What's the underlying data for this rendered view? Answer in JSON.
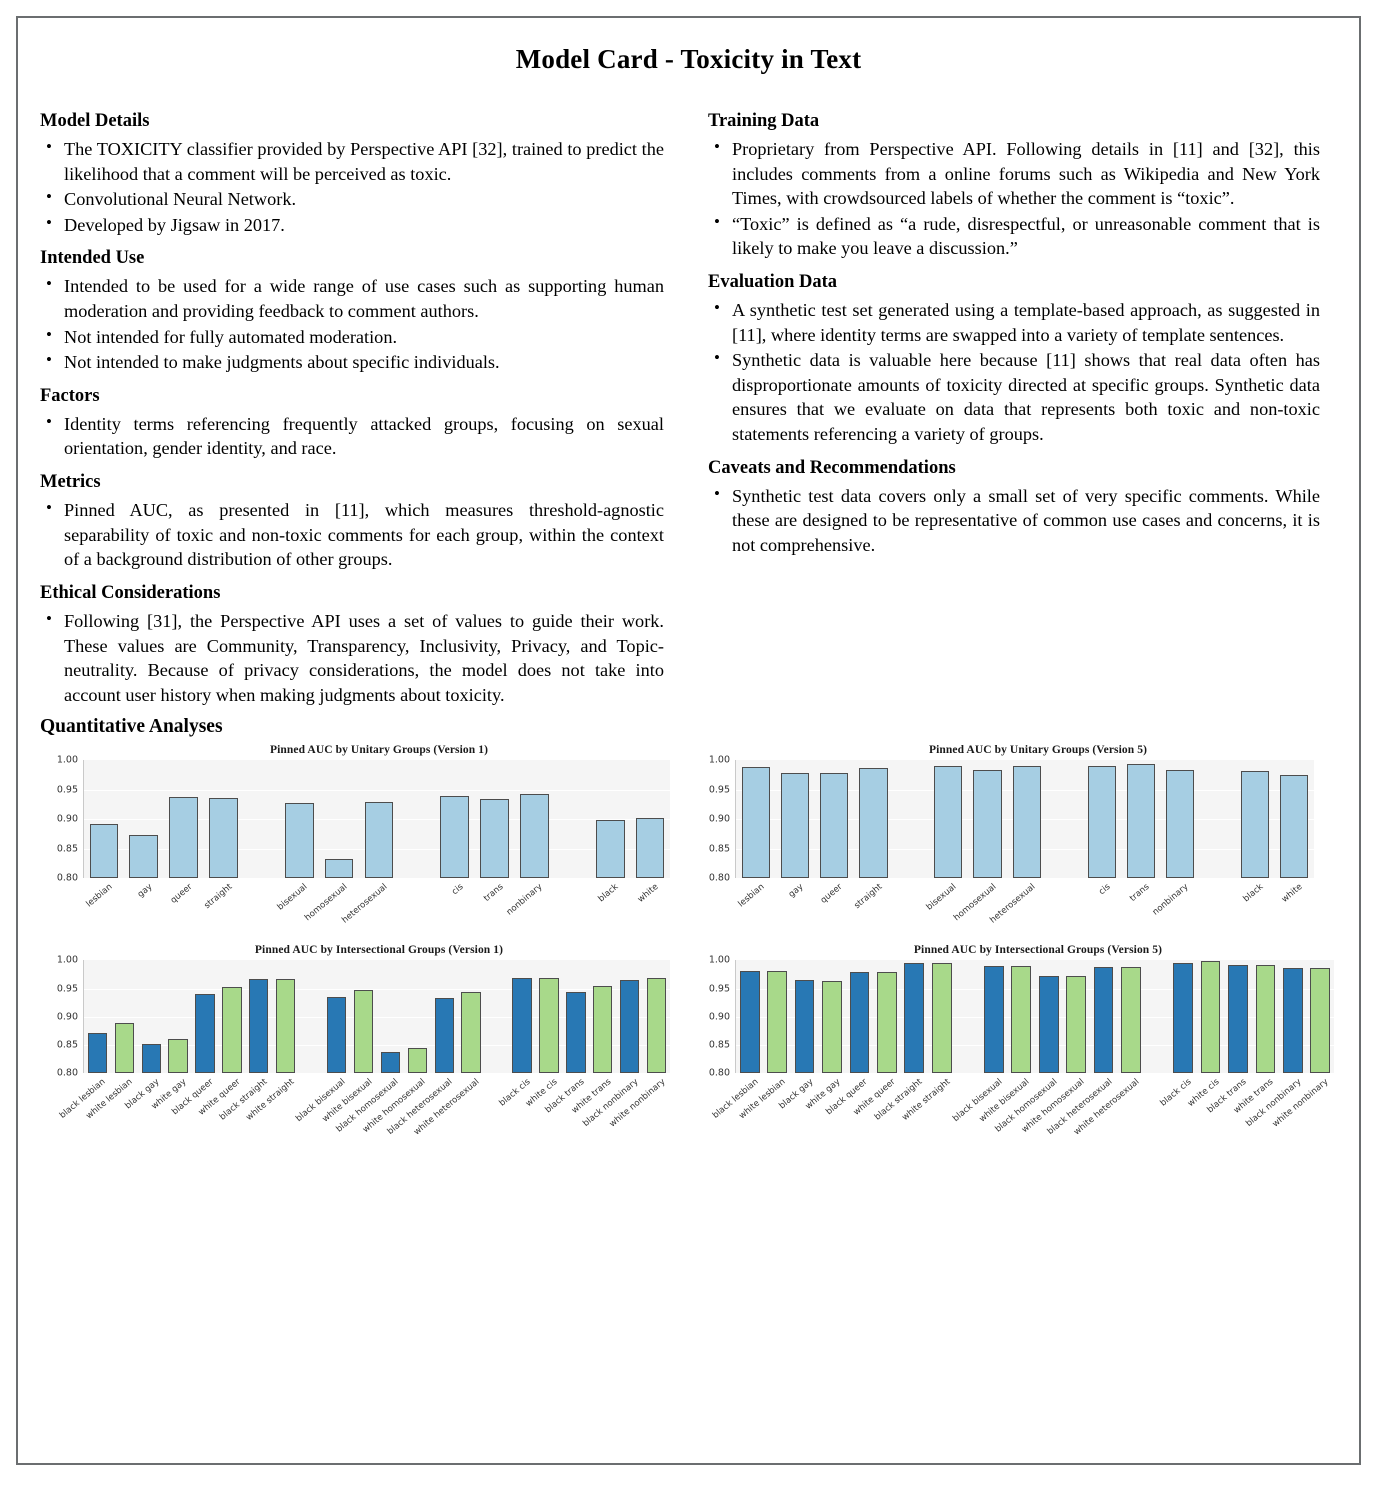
{
  "document": {
    "title": "Model Card - Toxicity in Text",
    "quantitative_analyses_heading": "Quantitative Analyses"
  },
  "left_column": [
    {
      "heading": "Model Details",
      "bullets": [
        "The TOXICITY classifier provided by Perspective API [32], trained to predict the likelihood that a comment will be perceived as toxic.",
        "Convolutional Neural Network.",
        "Developed by Jigsaw in 2017."
      ]
    },
    {
      "heading": "Intended Use",
      "bullets": [
        "Intended to be used for a wide range of use cases such as supporting human moderation and providing feedback to comment authors.",
        "Not intended for fully automated moderation.",
        "Not intended to make judgments about specific individuals."
      ]
    },
    {
      "heading": "Factors",
      "bullets": [
        "Identity terms referencing frequently attacked groups, focusing on sexual orientation, gender identity, and race."
      ]
    },
    {
      "heading": "Metrics",
      "bullets": [
        "Pinned AUC, as presented in [11], which measures threshold-agnostic separability of toxic and non-toxic comments for each group, within the context of a background distribution of other groups."
      ]
    },
    {
      "heading": "Ethical Considerations",
      "bullets": [
        "Following [31], the Perspective API uses a set of values to guide their work. These values are Community, Transparency, Inclusivity, Privacy, and Topic-neutrality. Because of privacy considerations, the model does not take into account user history when making judgments about toxicity."
      ]
    }
  ],
  "right_column": [
    {
      "heading": "Training Data",
      "bullets": [
        "Proprietary from Perspective API. Following details in [11] and [32], this includes comments from a online forums such as Wikipedia and New York Times, with crowdsourced labels of whether the comment is “toxic”.",
        "“Toxic” is defined as “a rude, disrespectful, or unreasonable comment that is likely to make you leave a discussion.”"
      ]
    },
    {
      "heading": "Evaluation Data",
      "bullets": [
        "A synthetic test set generated using a template-based approach, as suggested in [11], where identity terms are swapped into a variety of template sentences.",
        "Synthetic data is valuable here because [11] shows that real data often has disproportionate amounts of toxicity directed at specific groups. Synthetic data ensures that we evaluate on data that represents both toxic and non-toxic statements referencing a variety of groups."
      ]
    },
    {
      "heading": "Caveats and Recommendations",
      "bullets": [
        "Synthetic test data covers only a small set of very specific comments. While these are designed to be representative of common use cases and concerns, it is not comprehensive."
      ]
    }
  ],
  "colors": {
    "unitary_bar": "#a6cee3",
    "intersectional_black_bar": "#2878b4",
    "intersectional_white_bar": "#a8d98a",
    "bar_edge": "#4d4d4d",
    "plot_background": "#f5f5f5",
    "gridline": "#ffffff",
    "page_border": "#6b6e70"
  },
  "chart_data": [
    {
      "id": "unitary-v1",
      "type": "bar",
      "title": "Pinned AUC by Unitary Groups (Version 1)",
      "xlabel": "",
      "ylabel": "",
      "ylim": [
        0.8,
        1.0
      ],
      "yticks": [
        "0.80",
        "0.85",
        "0.90",
        "0.95",
        "1.00"
      ],
      "grid": true,
      "legend": "none",
      "group_gaps_after": [
        3,
        6,
        9
      ],
      "categories": [
        "lesbian",
        "gay",
        "queer",
        "straight",
        "bisexual",
        "homosexual",
        "heterosexual",
        "cis",
        "trans",
        "nonbinary",
        "black",
        "white"
      ],
      "values": [
        0.892,
        0.874,
        0.938,
        0.937,
        0.927,
        0.832,
        0.929,
        0.939,
        0.935,
        0.943,
        0.899,
        0.903
      ]
    },
    {
      "id": "unitary-v5",
      "type": "bar",
      "title": "Pinned AUC by Unitary Groups (Version 5)",
      "xlabel": "",
      "ylabel": "",
      "ylim": [
        0.8,
        1.0
      ],
      "yticks": [
        "0.80",
        "0.85",
        "0.90",
        "0.95",
        "1.00"
      ],
      "grid": true,
      "legend": "none",
      "group_gaps_after": [
        3,
        6,
        9
      ],
      "categories": [
        "lesbian",
        "gay",
        "queer",
        "straight",
        "bisexual",
        "homosexual",
        "heterosexual",
        "cis",
        "trans",
        "nonbinary",
        "black",
        "white"
      ],
      "values": [
        0.988,
        0.978,
        0.979,
        0.987,
        0.99,
        0.983,
        0.99,
        0.991,
        0.993,
        0.983,
        0.982,
        0.975
      ]
    },
    {
      "id": "intersectional-v1",
      "type": "bar",
      "title": "Pinned AUC by Intersectional Groups (Version 1)",
      "xlabel": "",
      "ylabel": "",
      "ylim": [
        0.8,
        1.0
      ],
      "yticks": [
        "0.80",
        "0.85",
        "0.90",
        "0.95",
        "1.00"
      ],
      "grid": true,
      "legend": "none",
      "group_gaps_after": [
        7,
        13
      ],
      "categories": [
        "black lesbian",
        "white lesbian",
        "black gay",
        "white gay",
        "black queer",
        "white queer",
        "black straight",
        "white straight",
        "black bisexual",
        "white bisexual",
        "black homosexual",
        "white homosexual",
        "black heterosexual",
        "white heterosexual",
        "black cis",
        "white cis",
        "black trans",
        "white trans",
        "black nonbinary",
        "white nonbinary"
      ],
      "values": [
        0.872,
        0.889,
        0.852,
        0.86,
        0.94,
        0.953,
        0.967,
        0.967,
        0.936,
        0.948,
        0.838,
        0.844,
        0.933,
        0.944,
        0.968,
        0.968,
        0.944,
        0.954,
        0.965,
        0.969
      ],
      "bar_races": [
        "black",
        "white",
        "black",
        "white",
        "black",
        "white",
        "black",
        "white",
        "black",
        "white",
        "black",
        "white",
        "black",
        "white",
        "black",
        "white",
        "black",
        "white",
        "black",
        "white"
      ]
    },
    {
      "id": "intersectional-v5",
      "type": "bar",
      "title": "Pinned AUC by Intersectional Groups (Version 5)",
      "xlabel": "",
      "ylabel": "",
      "ylim": [
        0.8,
        1.0
      ],
      "yticks": [
        "0.80",
        "0.85",
        "0.90",
        "0.95",
        "1.00"
      ],
      "grid": true,
      "legend": "none",
      "group_gaps_after": [
        7,
        13
      ],
      "categories": [
        "black lesbian",
        "white lesbian",
        "black gay",
        "white gay",
        "black queer",
        "white queer",
        "black straight",
        "white straight",
        "black bisexual",
        "white bisexual",
        "black homosexual",
        "white homosexual",
        "black heterosexual",
        "white heterosexual",
        "black cis",
        "white cis",
        "black trans",
        "white trans",
        "black nonbinary",
        "white nonbinary"
      ],
      "values": [
        0.982,
        0.982,
        0.966,
        0.964,
        0.979,
        0.98,
        0.995,
        0.996,
        0.99,
        0.99,
        0.973,
        0.972,
        0.988,
        0.988,
        0.996,
        0.998,
        0.991,
        0.992,
        0.987,
        0.986
      ],
      "bar_races": [
        "black",
        "white",
        "black",
        "white",
        "black",
        "white",
        "black",
        "white",
        "black",
        "white",
        "black",
        "white",
        "black",
        "white",
        "black",
        "white",
        "black",
        "white",
        "black",
        "white"
      ]
    }
  ]
}
